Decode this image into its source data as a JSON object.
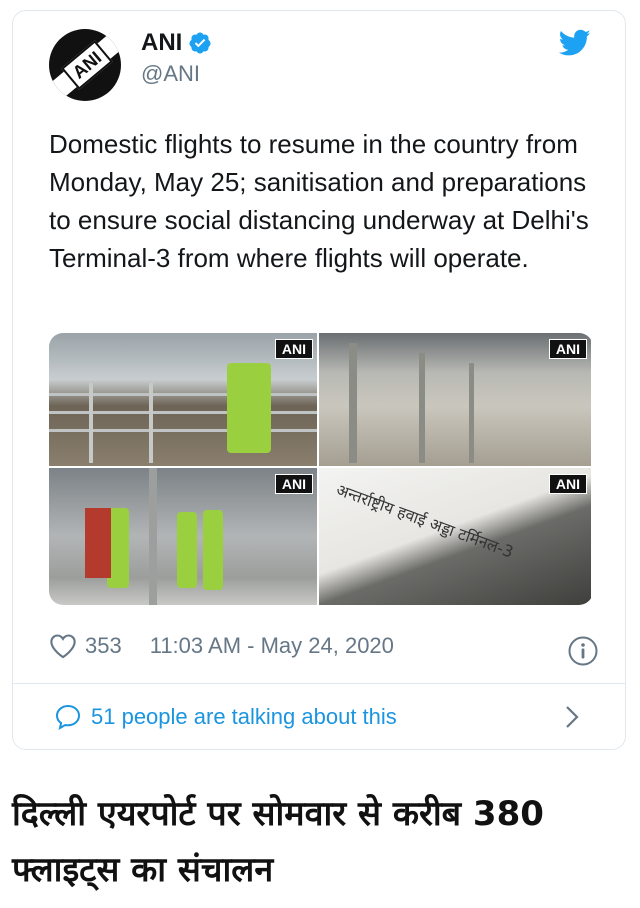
{
  "tweet": {
    "author_name": "ANI",
    "handle": "@ANI",
    "avatar_text": "ANI",
    "text": "Domestic flights to resume in the country from Monday, May 25; sanitisation and preparations to ensure social distancing underway at Delhi's Terminal-3 from where flights will operate.",
    "media": [
      {
        "watermark": "ANI"
      },
      {
        "watermark": "ANI"
      },
      {
        "watermark": "ANI"
      },
      {
        "watermark": "ANI",
        "sign_text": "अन्तर्राष्ट्रीय हवाई अड्डा टर्मिनल-3"
      }
    ],
    "like_count": "353",
    "timestamp": "11:03 AM - May 24, 2020",
    "conversation_label": "51 people are talking about this"
  },
  "headline": "दिल्ली एयरपोर्ट पर सोमवार से करीब 380 फ्लाइट्स का संचालन",
  "colors": {
    "twitter_blue": "#1da1f2",
    "link_blue": "#1b95e0",
    "meta_gray": "#657786",
    "border": "#e1e8ed"
  },
  "icons": [
    "verified-badge-icon",
    "twitter-bird-icon",
    "heart-icon",
    "info-icon",
    "speech-bubble-icon",
    "chevron-right-icon"
  ]
}
